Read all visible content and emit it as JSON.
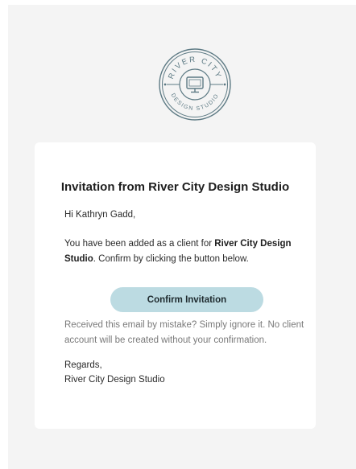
{
  "logo": {
    "top_text": "RIVER CITY",
    "bottom_text": "DESIGN STUDIO",
    "icon": "monitor-icon",
    "color": "#5d7a84"
  },
  "email": {
    "title": "Invitation from River City Design Studio",
    "greeting": "Hi Kathryn Gadd,",
    "message_before": "You have been added as a client for ",
    "message_company": "River City Design Studio",
    "message_after": ". Confirm by clicking the button below.",
    "confirm_label": "Confirm Invitation",
    "mistake_text": "Received this email by mistake? Simply ignore it. No client account will be created without your confirmation.",
    "regards": "Regards,",
    "signature": "River City Design Studio"
  },
  "colors": {
    "background": "#f4f4f4",
    "card": "#ffffff",
    "button": "#bcdbe2",
    "muted_text": "#7a7a7a"
  }
}
